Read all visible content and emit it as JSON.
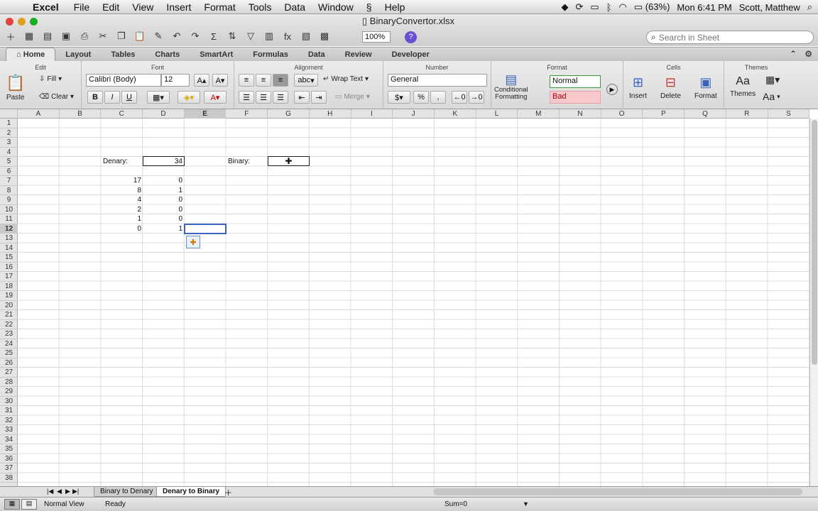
{
  "menubar": {
    "app": "Excel",
    "items": [
      "File",
      "Edit",
      "View",
      "Insert",
      "Format",
      "Tools",
      "Data",
      "Window",
      "Help"
    ],
    "battery": "(63%)",
    "clock": "Mon 6:41 PM",
    "user": "Scott, Matthew"
  },
  "window": {
    "doc_title": "BinaryConvertor.xlsx",
    "zoom": "100%",
    "search_placeholder": "Search in Sheet"
  },
  "tabs": [
    "Home",
    "Layout",
    "Tables",
    "Charts",
    "SmartArt",
    "Formulas",
    "Data",
    "Review",
    "Developer"
  ],
  "ribbon": {
    "edit": {
      "title": "Edit",
      "paste": "Paste",
      "fill": "Fill",
      "clear": "Clear"
    },
    "font": {
      "title": "Font",
      "name": "Calibri (Body)",
      "size": "12",
      "bold": "B",
      "italic": "I",
      "underline": "U"
    },
    "alignment": {
      "title": "Alignment",
      "wrap": "Wrap Text",
      "merge": "Merge",
      "abc": "abc"
    },
    "number": {
      "title": "Number",
      "format": "General",
      "percent": "%"
    },
    "format": {
      "title": "Format",
      "cond_line1": "Conditional",
      "cond_line2": "Formatting",
      "style_normal": "Normal",
      "style_bad": "Bad"
    },
    "cells": {
      "title": "Cells",
      "insert": "Insert",
      "delete": "Delete",
      "format": "Format"
    },
    "themes": {
      "title": "Themes",
      "themes": "Themes",
      "aa": "Aa"
    }
  },
  "columns": [
    "A",
    "B",
    "C",
    "D",
    "E",
    "F",
    "G",
    "H",
    "I",
    "J",
    "K",
    "L",
    "M",
    "N",
    "O",
    "P",
    "Q",
    "R",
    "S"
  ],
  "rows": [
    "1",
    "2",
    "3",
    "4",
    "5",
    "6",
    "7",
    "8",
    "9",
    "10",
    "11",
    "12",
    "13",
    "14",
    "15",
    "16",
    "17",
    "18",
    "19",
    "20",
    "21",
    "22",
    "23",
    "24",
    "25",
    "26",
    "27",
    "28",
    "29",
    "30",
    "31",
    "32",
    "33",
    "34",
    "35",
    "36",
    "37",
    "38"
  ],
  "cells": {
    "denary_label": "Denary:",
    "denary_value": "34",
    "binary_label": "Binary:",
    "col_c": [
      "17",
      "8",
      "4",
      "2",
      "1",
      "0"
    ],
    "col_d": [
      "0",
      "1",
      "0",
      "0",
      "0",
      "1"
    ]
  },
  "sheets": [
    "Binary to Denary",
    "Denary to Binary"
  ],
  "status": {
    "view": "Normal View",
    "state": "Ready",
    "sum": "Sum=0"
  }
}
